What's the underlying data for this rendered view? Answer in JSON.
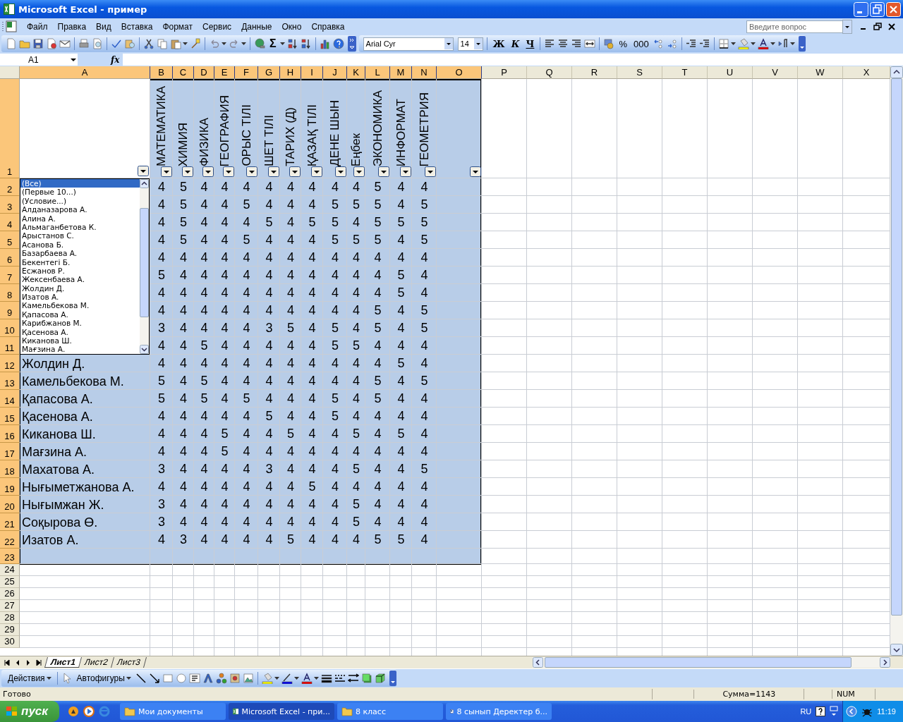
{
  "window": {
    "title": "Microsoft Excel - пример"
  },
  "menu": {
    "items": [
      "Файл",
      "Правка",
      "Вид",
      "Вставка",
      "Формат",
      "Сервис",
      "Данные",
      "Окно",
      "Справка"
    ],
    "help_placeholder": "Введите вопрос"
  },
  "toolbar": {
    "sum": "Σ",
    "font": "Arial Cyr",
    "size": "14",
    "bold": "Ж",
    "italic": "К",
    "underline": "Ч",
    "percent": "%",
    "thousands": "000"
  },
  "formula_bar": {
    "name_box": "A1",
    "fx": "fx"
  },
  "sheet": {
    "columns": [
      {
        "label": "A",
        "selected": true,
        "filter": true
      },
      {
        "label": "B",
        "selected": true,
        "filter": true
      },
      {
        "label": "C",
        "selected": true,
        "filter": true
      },
      {
        "label": "D",
        "selected": true,
        "filter": true
      },
      {
        "label": "E",
        "selected": true,
        "filter": true
      },
      {
        "label": "F",
        "selected": true,
        "filter": true
      },
      {
        "label": "G",
        "selected": true,
        "filter": true
      },
      {
        "label": "H",
        "selected": true,
        "filter": true
      },
      {
        "label": "I",
        "selected": true,
        "filter": true
      },
      {
        "label": "J",
        "selected": true,
        "filter": true
      },
      {
        "label": "K",
        "selected": true,
        "filter": true
      },
      {
        "label": "L",
        "selected": true,
        "filter": true
      },
      {
        "label": "M",
        "selected": true,
        "filter": true
      },
      {
        "label": "N",
        "selected": true,
        "filter": true
      },
      {
        "label": "O",
        "selected": true,
        "filter": true
      },
      {
        "label": "P",
        "selected": false,
        "filter": false
      },
      {
        "label": "Q",
        "selected": false,
        "filter": false
      },
      {
        "label": "R",
        "selected": false,
        "filter": false
      },
      {
        "label": "S",
        "selected": false,
        "filter": false
      },
      {
        "label": "T",
        "selected": false,
        "filter": false
      },
      {
        "label": "U",
        "selected": false,
        "filter": false
      },
      {
        "label": "V",
        "selected": false,
        "filter": false
      },
      {
        "label": "W",
        "selected": false,
        "filter": false
      },
      {
        "label": "X",
        "selected": false,
        "filter": false
      }
    ],
    "rows": [
      {
        "kind": "header",
        "number": "1",
        "selected": true,
        "headings": [
          "МАТЕМАТИКА",
          "ХИМИЯ",
          "ФИЗИКА",
          "ГЕОГРАФИЯ",
          "ОРЫС ТІЛІ",
          "ШЕТ ТІЛІ",
          "ТАРИХ (Д)",
          "ҚАЗАҚ ТІЛІ",
          "ДЕНЕ ШЫН",
          "Еңбек",
          "ЭКОНОМИКА",
          "ИНФОРМАТ",
          "ГЕОМЕТРИЯ"
        ]
      },
      {
        "kind": "data",
        "number": "2",
        "selected": true,
        "scores": [
          "4",
          "5",
          "4",
          "4",
          "4",
          "4",
          "4",
          "4",
          "4",
          "4",
          "5",
          "4",
          "4"
        ]
      },
      {
        "kind": "data",
        "number": "3",
        "selected": true,
        "scores": [
          "4",
          "5",
          "4",
          "4",
          "5",
          "4",
          "4",
          "4",
          "5",
          "5",
          "5",
          "4",
          "5"
        ]
      },
      {
        "kind": "data",
        "number": "4",
        "selected": true,
        "scores": [
          "4",
          "5",
          "4",
          "4",
          "4",
          "5",
          "4",
          "5",
          "5",
          "4",
          "5",
          "5",
          "5"
        ]
      },
      {
        "kind": "data",
        "number": "5",
        "selected": true,
        "scores": [
          "4",
          "5",
          "4",
          "4",
          "5",
          "4",
          "4",
          "4",
          "5",
          "5",
          "5",
          "4",
          "5"
        ]
      },
      {
        "kind": "data",
        "number": "6",
        "selected": true,
        "scores": [
          "4",
          "4",
          "4",
          "4",
          "4",
          "4",
          "4",
          "4",
          "4",
          "4",
          "4",
          "4",
          "4"
        ]
      },
      {
        "kind": "data",
        "number": "7",
        "selected": true,
        "scores": [
          "5",
          "4",
          "4",
          "4",
          "4",
          "4",
          "4",
          "4",
          "4",
          "4",
          "4",
          "5",
          "4"
        ]
      },
      {
        "kind": "data",
        "number": "8",
        "selected": true,
        "scores": [
          "4",
          "4",
          "4",
          "4",
          "4",
          "4",
          "4",
          "4",
          "4",
          "4",
          "4",
          "5",
          "4"
        ]
      },
      {
        "kind": "data",
        "number": "9",
        "selected": true,
        "scores": [
          "4",
          "4",
          "4",
          "4",
          "4",
          "4",
          "4",
          "4",
          "4",
          "4",
          "5",
          "4",
          "5"
        ]
      },
      {
        "kind": "data",
        "number": "10",
        "selected": true,
        "scores": [
          "3",
          "4",
          "4",
          "4",
          "4",
          "3",
          "5",
          "4",
          "5",
          "4",
          "5",
          "4",
          "5"
        ]
      },
      {
        "kind": "data",
        "number": "11",
        "selected": true,
        "scores": [
          "4",
          "4",
          "5",
          "4",
          "4",
          "4",
          "4",
          "4",
          "5",
          "5",
          "4",
          "4",
          "4"
        ]
      },
      {
        "kind": "data",
        "number": "12",
        "selected": true,
        "name": "Жолдин Д.",
        "scores": [
          "4",
          "4",
          "4",
          "4",
          "4",
          "4",
          "4",
          "4",
          "4",
          "4",
          "4",
          "5",
          "4"
        ]
      },
      {
        "kind": "data",
        "number": "13",
        "selected": true,
        "name": "Камельбекова М.",
        "scores": [
          "5",
          "4",
          "5",
          "4",
          "4",
          "4",
          "4",
          "4",
          "4",
          "4",
          "5",
          "4",
          "5"
        ]
      },
      {
        "kind": "data",
        "number": "14",
        "selected": true,
        "name": "Қапасова А.",
        "scores": [
          "5",
          "4",
          "5",
          "4",
          "5",
          "4",
          "4",
          "4",
          "5",
          "4",
          "5",
          "4",
          "4"
        ]
      },
      {
        "kind": "data",
        "number": "15",
        "selected": true,
        "name": "Қасенова А.",
        "scores": [
          "4",
          "4",
          "4",
          "4",
          "4",
          "5",
          "4",
          "4",
          "5",
          "4",
          "4",
          "4",
          "4"
        ]
      },
      {
        "kind": "data",
        "number": "16",
        "selected": true,
        "name": "Киканова Ш.",
        "scores": [
          "4",
          "4",
          "4",
          "5",
          "4",
          "4",
          "5",
          "4",
          "4",
          "5",
          "4",
          "5",
          "4"
        ]
      },
      {
        "kind": "data",
        "number": "17",
        "selected": true,
        "name": "Мағзина А.",
        "scores": [
          "4",
          "4",
          "4",
          "5",
          "4",
          "4",
          "4",
          "4",
          "4",
          "4",
          "4",
          "4",
          "4"
        ]
      },
      {
        "kind": "data",
        "number": "18",
        "selected": true,
        "name": "Махатова А.",
        "scores": [
          "3",
          "4",
          "4",
          "4",
          "4",
          "3",
          "4",
          "4",
          "4",
          "5",
          "4",
          "4",
          "5"
        ]
      },
      {
        "kind": "data",
        "number": "19",
        "selected": true,
        "name": "Нығыметжанова А.",
        "scores": [
          "4",
          "4",
          "4",
          "4",
          "4",
          "4",
          "4",
          "5",
          "4",
          "4",
          "4",
          "4",
          "4"
        ]
      },
      {
        "kind": "data",
        "number": "20",
        "selected": true,
        "name": "Нығымжан Ж.",
        "scores": [
          "3",
          "4",
          "4",
          "4",
          "4",
          "4",
          "4",
          "4",
          "4",
          "5",
          "4",
          "4",
          "4"
        ]
      },
      {
        "kind": "data",
        "number": "21",
        "selected": true,
        "name": "Соқырова Ө.",
        "scores": [
          "3",
          "4",
          "4",
          "4",
          "4",
          "4",
          "4",
          "4",
          "4",
          "5",
          "4",
          "4",
          "4"
        ]
      },
      {
        "kind": "data",
        "number": "22",
        "selected": true,
        "name": "Изатов А.",
        "scores": [
          "4",
          "3",
          "4",
          "4",
          "4",
          "4",
          "5",
          "4",
          "4",
          "4",
          "5",
          "5",
          "4"
        ]
      },
      {
        "kind": "blank",
        "number": "23",
        "selected": true
      },
      {
        "kind": "blank",
        "number": "24",
        "selected": false
      },
      {
        "kind": "blank",
        "number": "25",
        "selected": false
      },
      {
        "kind": "blank",
        "number": "26",
        "selected": false
      },
      {
        "kind": "blank",
        "number": "27",
        "selected": false
      },
      {
        "kind": "blank",
        "number": "28",
        "selected": false
      },
      {
        "kind": "blank",
        "number": "29",
        "selected": false
      },
      {
        "kind": "blank",
        "number": "30",
        "selected": false
      }
    ]
  },
  "filter_list": {
    "items": [
      {
        "label": "(Все)",
        "selected": true
      },
      {
        "label": "(Первые 10...)",
        "selected": false
      },
      {
        "label": "(Условие...)",
        "selected": false
      },
      {
        "label": "Алданазарова А.",
        "selected": false
      },
      {
        "label": "Алина А.",
        "selected": false
      },
      {
        "label": "Альмаганбетова К.",
        "selected": false
      },
      {
        "label": "Арыстанов С.",
        "selected": false
      },
      {
        "label": "Асанова Б.",
        "selected": false
      },
      {
        "label": "Базарбаева А.",
        "selected": false
      },
      {
        "label": "Бекентегі Б.",
        "selected": false
      },
      {
        "label": "Есжанов Р.",
        "selected": false
      },
      {
        "label": "Жексенбаева А.",
        "selected": false
      },
      {
        "label": "Жолдин Д.",
        "selected": false
      },
      {
        "label": "Изатов А.",
        "selected": false
      },
      {
        "label": "Камельбекова М.",
        "selected": false
      },
      {
        "label": "Қапасова А.",
        "selected": false
      },
      {
        "label": "Карибжанов М.",
        "selected": false
      },
      {
        "label": "Қасенова А.",
        "selected": false
      },
      {
        "label": "Киканова Ш.",
        "selected": false
      },
      {
        "label": "Мағзина А.",
        "selected": false
      }
    ]
  },
  "sheet_tabs": [
    {
      "label": "Лист1",
      "selected": true
    },
    {
      "label": "Лист2",
      "selected": false
    },
    {
      "label": "Лист3",
      "selected": false
    }
  ],
  "drawing_toolbar": {
    "actions": "Действия",
    "autoshapes": "Автофигуры"
  },
  "status_bar": {
    "state": "Готово",
    "sum": "Сумма=1143",
    "num": "NUM"
  },
  "taskbar": {
    "start": "пуск",
    "tasks": [
      {
        "label": "Мои документы",
        "selected": false,
        "kind": "folder"
      },
      {
        "label": "Microsoft Excel - при...",
        "selected": true,
        "kind": "spreadsheet"
      },
      {
        "label": "8 класс",
        "selected": false,
        "kind": "folder"
      },
      {
        "label": "8 сынып Деректер б...",
        "selected": false,
        "kind": "document"
      }
    ],
    "language": "RU",
    "clock": "11:19"
  }
}
